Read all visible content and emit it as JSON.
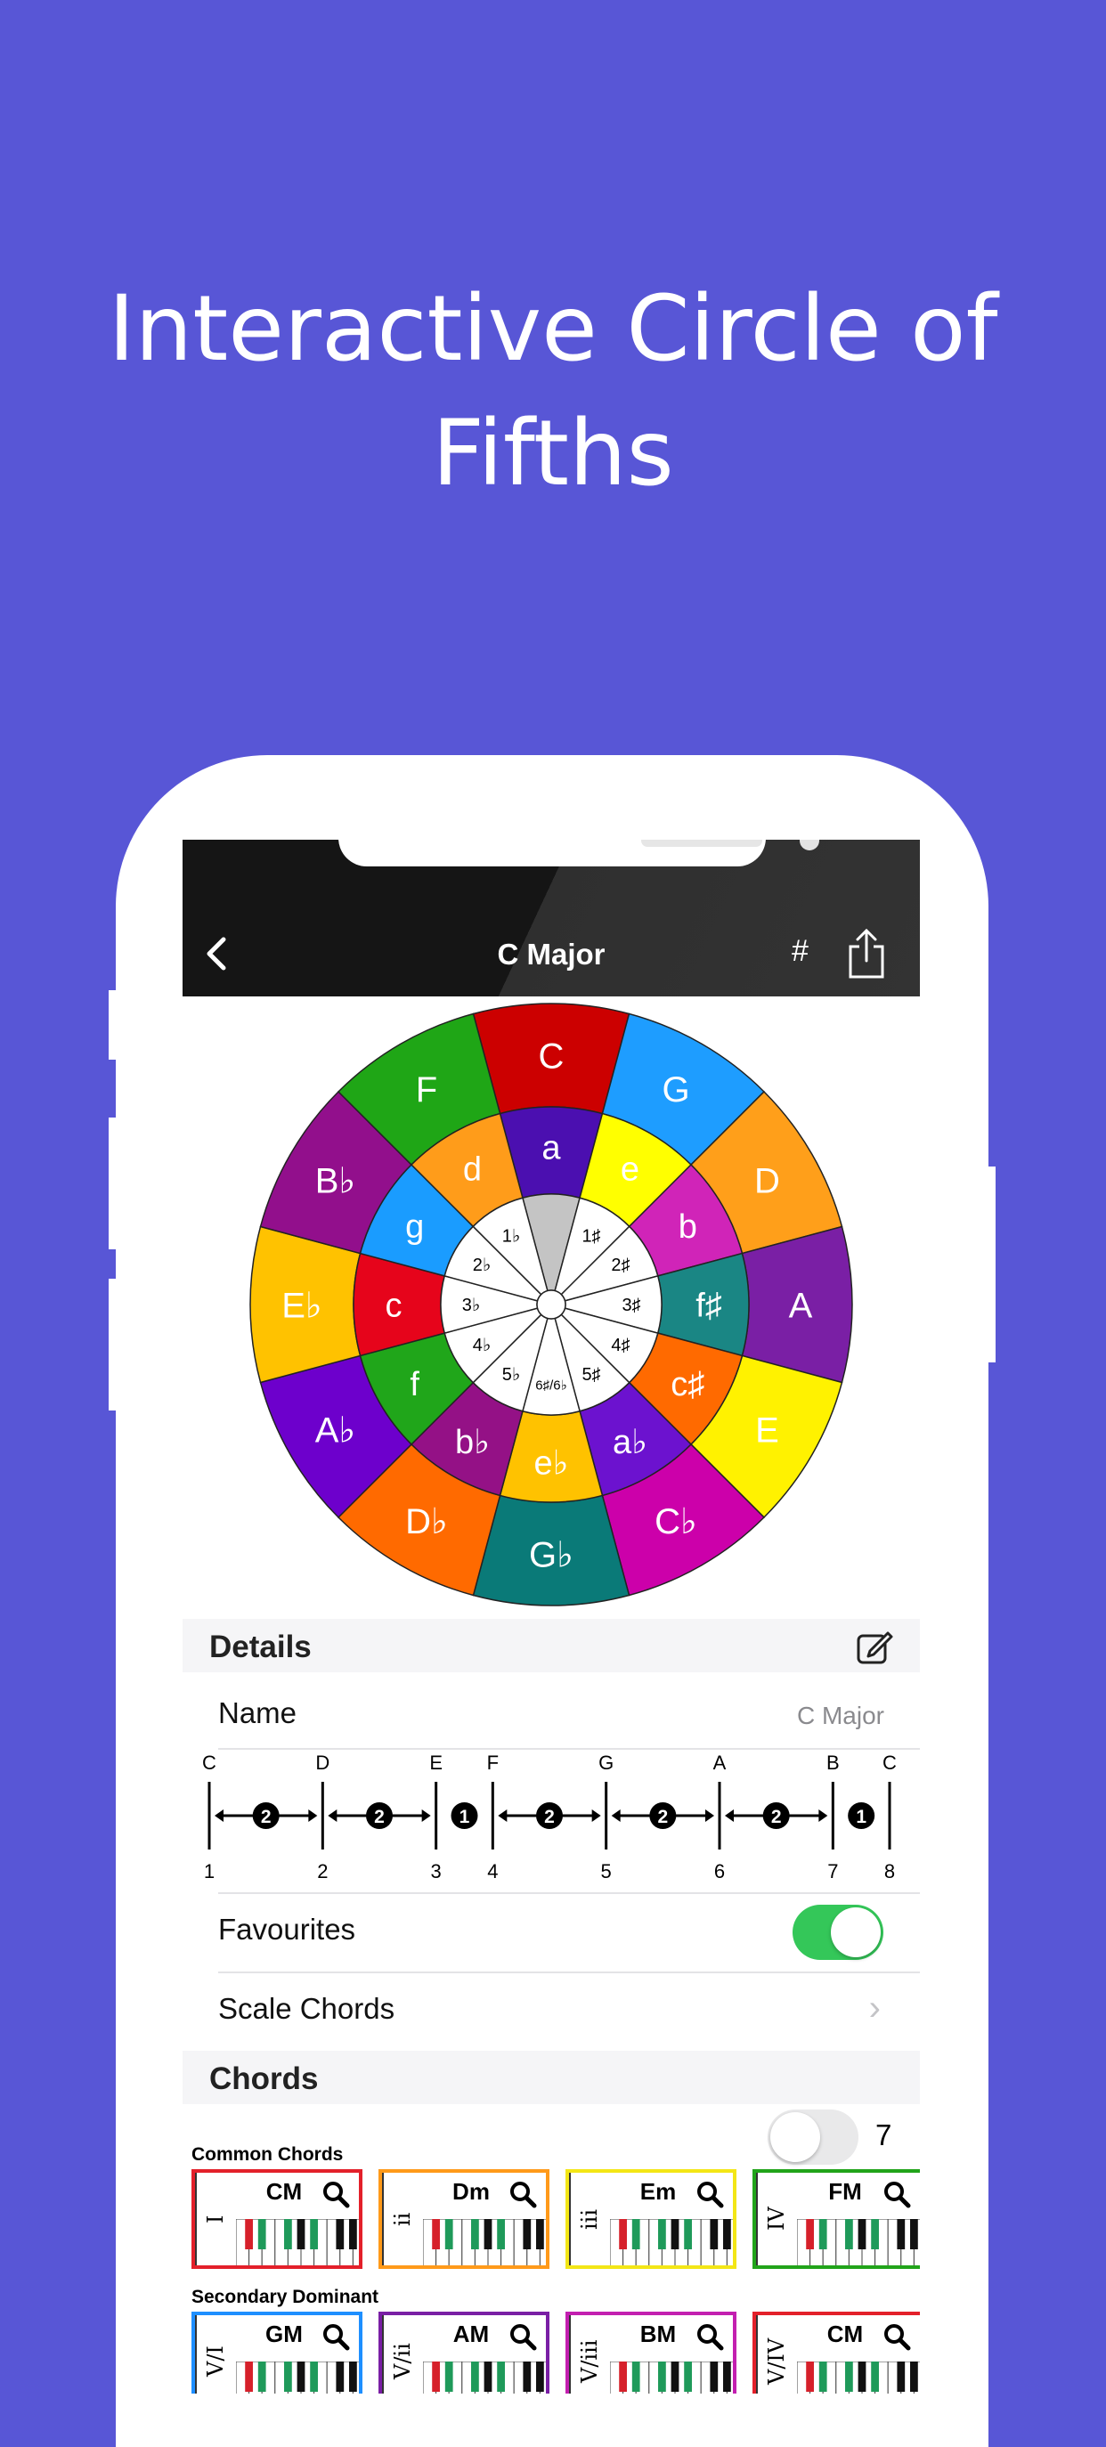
{
  "headline": "Interactive Circle of Fifths",
  "nav": {
    "title": "C Major",
    "sharp_label": "#"
  },
  "circle": {
    "outer": [
      {
        "label": "C",
        "color": "#cc0000"
      },
      {
        "label": "G",
        "color": "#1e9dff"
      },
      {
        "label": "D",
        "color": "#ff9f1a"
      },
      {
        "label": "A",
        "color": "#7a1fa5"
      },
      {
        "label": "E",
        "color": "#fff200"
      },
      {
        "label": "C♭",
        "color": "#cc00aa"
      },
      {
        "label": "G♭",
        "color": "#0a7a78"
      },
      {
        "label": "D♭",
        "color": "#ff6a00"
      },
      {
        "label": "A♭",
        "color": "#6d00cc"
      },
      {
        "label": "E♭",
        "color": "#ffc200"
      },
      {
        "label": "B♭",
        "color": "#920f8c"
      },
      {
        "label": "F",
        "color": "#1fa616"
      }
    ],
    "inner": [
      {
        "label": "a",
        "color": "#4b0fb0"
      },
      {
        "label": "e",
        "color": "#ffff00"
      },
      {
        "label": "b",
        "color": "#d024b8"
      },
      {
        "label": "f♯",
        "color": "#1a8684"
      },
      {
        "label": "c♯",
        "color": "#ff6a00"
      },
      {
        "label": "a♭",
        "color": "#6c12cf"
      },
      {
        "label": "e♭",
        "color": "#ffc200"
      },
      {
        "label": "b♭",
        "color": "#941186"
      },
      {
        "label": "f",
        "color": "#20a61a"
      },
      {
        "label": "c",
        "color": "#e6041b"
      },
      {
        "label": "g",
        "color": "#1a9cff"
      },
      {
        "label": "d",
        "color": "#ff9c1a"
      }
    ],
    "center": [
      "",
      "1♯",
      "2♯",
      "3♯",
      "4♯",
      "5♯",
      "6♯/6♭",
      "5♭",
      "4♭",
      "3♭",
      "2♭",
      "1♭"
    ]
  },
  "details": {
    "title": "Details",
    "name_label": "Name",
    "name_value": "C Major",
    "notes": [
      "C",
      "D",
      "E",
      "F",
      "G",
      "A",
      "B",
      "C"
    ],
    "degrees": [
      "1",
      "2",
      "3",
      "4",
      "5",
      "6",
      "7",
      "8"
    ],
    "steps": [
      "2",
      "2",
      "1",
      "2",
      "2",
      "2",
      "1"
    ],
    "favourites_label": "Favourites",
    "favourites_on": true,
    "scale_chords_label": "Scale Chords"
  },
  "chords": {
    "title": "Chords",
    "count": "7",
    "show_all_on": false,
    "common_label": "Common Chords",
    "common": [
      {
        "numeral": "I",
        "name": "CM",
        "color": "#e3202a"
      },
      {
        "numeral": "ii",
        "name": "Dm",
        "color": "#ff9a1a"
      },
      {
        "numeral": "iii",
        "name": "Em",
        "color": "#f3e616"
      },
      {
        "numeral": "IV",
        "name": "FM",
        "color": "#21a41a"
      }
    ],
    "secondary_label": "Secondary Dominant",
    "secondary": [
      {
        "numeral": "V/I",
        "name": "GM",
        "color": "#1e8fff"
      },
      {
        "numeral": "V/ii",
        "name": "AM",
        "color": "#7a1fa5"
      },
      {
        "numeral": "V/iii",
        "name": "BM",
        "color": "#c31fb0"
      },
      {
        "numeral": "V/IV",
        "name": "CM",
        "color": "#e3202a"
      }
    ]
  }
}
